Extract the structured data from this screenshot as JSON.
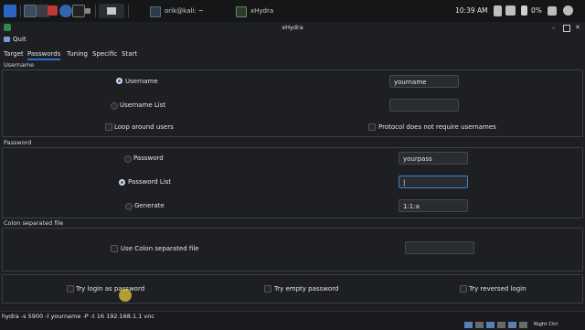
{
  "taskbar": {
    "tasks": [
      "orik@kali: ~",
      "xHydra"
    ],
    "clock": "10:39 AM",
    "battery": "0%",
    "accent": "#2f6fd1"
  },
  "window": {
    "title": "xHydra"
  },
  "menu": {
    "quit": "Quit"
  },
  "tabs": [
    {
      "label": "Target",
      "active": false
    },
    {
      "label": "Passwords",
      "active": true
    },
    {
      "label": "Tuning",
      "active": false
    },
    {
      "label": "Specific",
      "active": false
    },
    {
      "label": "Start",
      "active": false
    }
  ],
  "username_section": {
    "title": "Username",
    "username_label": "Username",
    "username_value": "yourname",
    "username_list_label": "Username List",
    "username_list_value": "",
    "loop_around_users": "Loop around users",
    "protocol_no_usernames": "Protocol does not require usernames"
  },
  "password_section": {
    "title": "Password",
    "password_label": "Password",
    "password_value": "yourpass",
    "password_list_label": "Password List",
    "password_list_value": "|",
    "generate_label": "Generate",
    "generate_value": "1:1:a"
  },
  "colon_section": {
    "title": "Colon separated file",
    "use_colon_label": "Use Colon separated file",
    "colon_value": ""
  },
  "options": {
    "try_login_as_password": "Try login as password",
    "try_empty_password": "Try empty password",
    "try_reversed_login": "Try reversed login"
  },
  "command_line": "hydra -s 5900 -l yourname -P  -t 16 192.168.1.1 vnc",
  "tray_status": "Right Ctrl"
}
